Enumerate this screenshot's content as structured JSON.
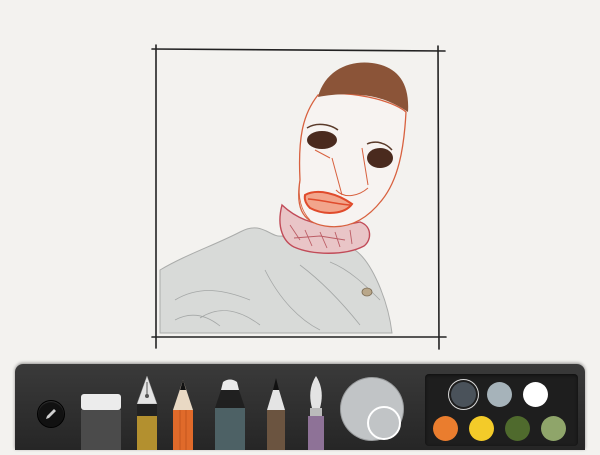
{
  "canvas": {
    "background": "#f3f2ef",
    "frame_color": "#222222",
    "skin_color": "#f7f3f1",
    "hair_color": "#8b5438",
    "eye_color": "#4a2a1e",
    "outline_red": "#d8613f",
    "lips_color": "#e76a4d",
    "collar_color": "#c98288",
    "jacket_color": "#b9bbba"
  },
  "toolbar": {
    "menu_icon": "pencil-icon",
    "tools": [
      {
        "name": "eraser",
        "icon": "eraser-icon",
        "color": "#4b4b4b"
      },
      {
        "name": "fountain-pen",
        "icon": "fountain-pen-icon",
        "color": "#b3902f"
      },
      {
        "name": "pencil",
        "icon": "pencil-icon",
        "color": "#e06a2a"
      },
      {
        "name": "marker",
        "icon": "marker-icon",
        "color": "#4d6165"
      },
      {
        "name": "outline-pen",
        "icon": "outline-pen-icon",
        "color": "#6b5440"
      },
      {
        "name": "brush",
        "icon": "brush-icon",
        "color": "#8e7297"
      }
    ],
    "mixer": {
      "icon": "color-mixer-icon",
      "color": "#c1c4c6",
      "current": "#c1c4c6"
    }
  },
  "palette": {
    "selected_index": 0,
    "swatches": [
      "#4a525a",
      "#a6b3ba",
      "#ffffff",
      "#ea7d2e",
      "#f3cb29",
      "#4f6a2d",
      "#8fa56a"
    ]
  }
}
